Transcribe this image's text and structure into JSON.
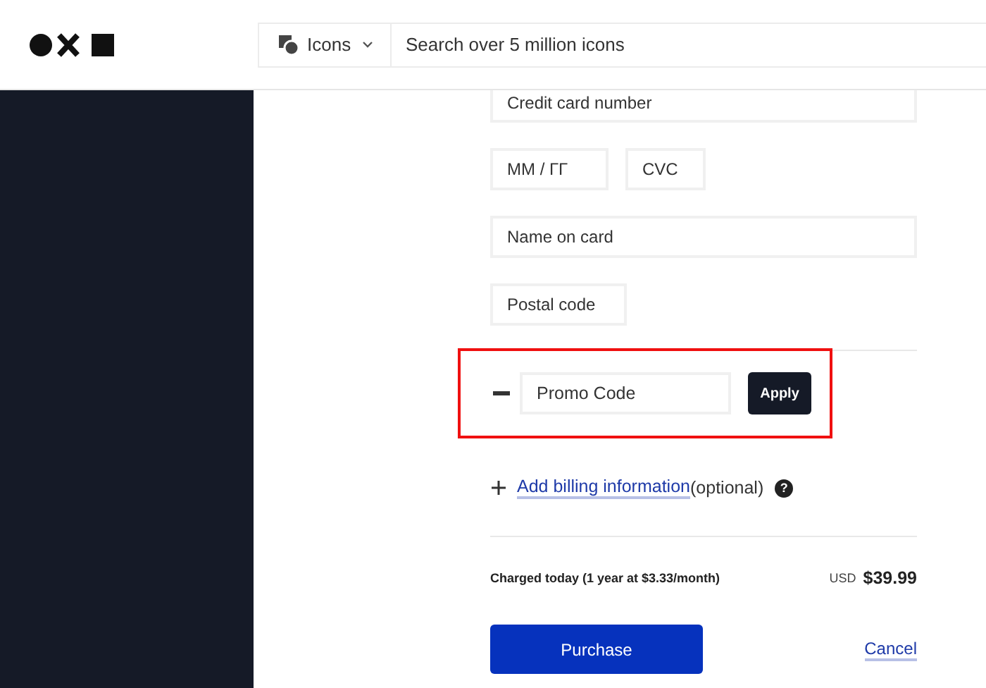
{
  "header": {
    "search": {
      "type_label": "Icons",
      "placeholder": "Search over 5 million icons"
    }
  },
  "payment_fields": [
    {
      "placeholder": "Credit card number"
    },
    {
      "placeholder": "MM / ГГ"
    },
    {
      "placeholder": "CVC"
    },
    {
      "placeholder": "Name on card"
    },
    {
      "placeholder": "Postal code"
    }
  ],
  "promo": {
    "expanded": true,
    "highlighted": true,
    "placeholder": "Promo Code",
    "button": "Apply"
  },
  "billing": {
    "expanded": false,
    "link": "Add billing information",
    "note": "(optional)",
    "help": "?"
  },
  "summary": {
    "label": "Charged today (1 year at $3.33/month)",
    "currency": "USD",
    "amount": "$39.99"
  },
  "actions": {
    "primary": "Purchase",
    "cancel": "Cancel"
  }
}
